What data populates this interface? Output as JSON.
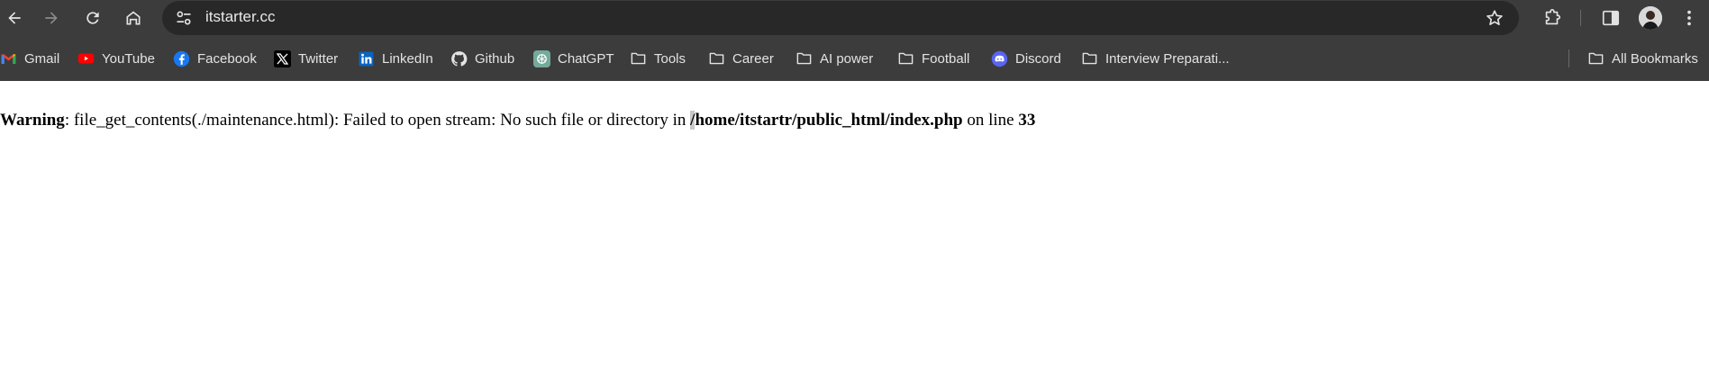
{
  "browser": {
    "url": "itstarter.cc"
  },
  "bookmarks": [
    {
      "label": "Gmail",
      "icon": "gmail-icon"
    },
    {
      "label": "YouTube",
      "icon": "youtube-icon"
    },
    {
      "label": "Facebook",
      "icon": "facebook-icon"
    },
    {
      "label": "Twitter",
      "icon": "x-twitter-icon"
    },
    {
      "label": "LinkedIn",
      "icon": "linkedin-icon"
    },
    {
      "label": "Github",
      "icon": "github-icon"
    },
    {
      "label": "ChatGPT",
      "icon": "chatgpt-icon"
    },
    {
      "label": "Tools",
      "icon": "folder-icon"
    },
    {
      "label": "Career",
      "icon": "folder-icon"
    },
    {
      "label": "AI power",
      "icon": "folder-icon"
    },
    {
      "label": "Football",
      "icon": "folder-icon"
    },
    {
      "label": "Discord",
      "icon": "discord-icon"
    },
    {
      "label": "Interview Preparati...",
      "icon": "folder-icon"
    }
  ],
  "all_bookmarks_label": "All Bookmarks",
  "page": {
    "warning_label": "Warning",
    "message": ": file_get_contents(./maintenance.html): Failed to open stream: No such file or directory in ",
    "path_first_char": "/",
    "path_rest": "home/itstartr/public_html/index.php",
    "line_text": " on line ",
    "line_number": "33"
  },
  "colors": {
    "chrome_bg": "#3c3c3c",
    "omnibox_bg": "#282828",
    "page_bg": "#ffffff"
  }
}
